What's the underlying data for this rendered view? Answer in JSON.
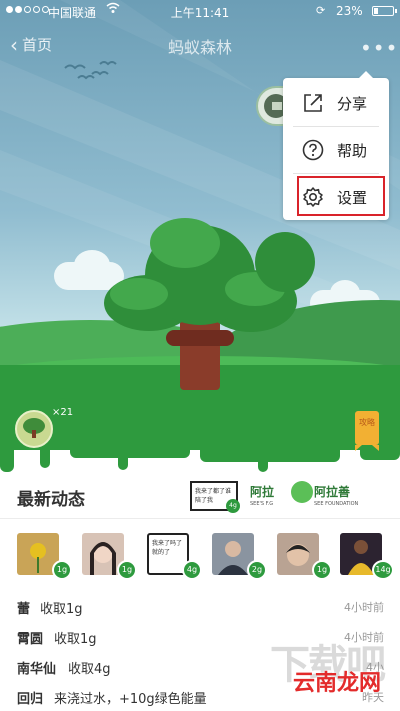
{
  "status_bar": {
    "carrier": "中国联通",
    "time": "上午11:41",
    "battery": "23%",
    "battery_level": 0.23
  },
  "nav": {
    "back_label": "首页",
    "title": "蚂蚁森林",
    "more": "•••"
  },
  "menu": {
    "items": [
      {
        "label": "分享",
        "icon": "share-icon"
      },
      {
        "label": "帮助",
        "icon": "help-icon"
      },
      {
        "label": "设置",
        "icon": "gear-icon"
      }
    ],
    "highlight_color": "#d9232a"
  },
  "scene": {
    "energy_count": "×21",
    "guide_label": "攻略"
  },
  "feed": {
    "title": "最新动态",
    "sponsor": {
      "frame_text": "我来了都了谁陪了我",
      "frame_badge": "4g",
      "logo1": "阿拉",
      "logo1_sub": "SEE'S F.G",
      "logo2": "阿拉善",
      "logo2_sub": "SEE FOUNDATION"
    },
    "avatars": [
      {
        "badge": "1g"
      },
      {
        "badge": "1g"
      },
      {
        "badge": "4g",
        "text": "我来了吗了就的了"
      },
      {
        "badge": "2g"
      },
      {
        "badge": "1g"
      },
      {
        "badge": "14g"
      }
    ],
    "rows": [
      {
        "name": "蕾",
        "action": "收取1g",
        "time": "4小时前"
      },
      {
        "name": "霄圆",
        "action": "收取1g",
        "time": "4小时前"
      },
      {
        "name": "南华仙",
        "action": "收取4g",
        "time": "4小"
      },
      {
        "name": "回归",
        "action": "来浇过水，+10g绿色能量",
        "time": "昨天"
      }
    ]
  },
  "watermark": {
    "big": "下载吧",
    "site": "云南龙网"
  }
}
